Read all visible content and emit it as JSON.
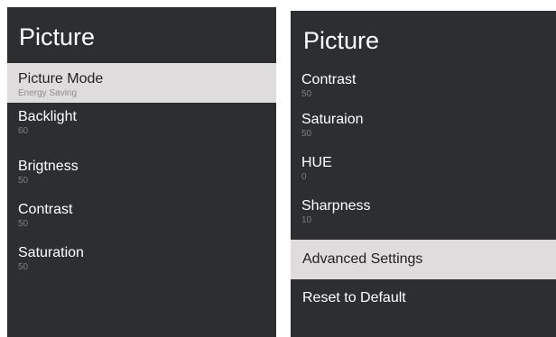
{
  "left_panel": {
    "title": "Picture",
    "items": [
      {
        "label": "Picture Mode",
        "value": "Energy Saving",
        "selected": true
      },
      {
        "label": "Backlight",
        "value": "60"
      },
      {
        "label": "Brigtness",
        "value": "50"
      },
      {
        "label": "Contrast",
        "value": "50"
      },
      {
        "label": "Saturation",
        "value": "50"
      }
    ]
  },
  "right_panel": {
    "title": "Picture",
    "items": [
      {
        "label": "Contrast",
        "value": "50"
      },
      {
        "label": "Saturaion",
        "value": "50"
      },
      {
        "label": "HUE",
        "value": "0"
      },
      {
        "label": "Sharpness",
        "value": "10"
      },
      {
        "label": "Advanced Settings",
        "selected": true
      },
      {
        "label": "Reset to Default"
      }
    ]
  },
  "colors": {
    "panel_background": "#2d2e2f",
    "selected_background": "#dfdcdd",
    "text": "#ffffff",
    "value_text": "#7d7f82"
  }
}
